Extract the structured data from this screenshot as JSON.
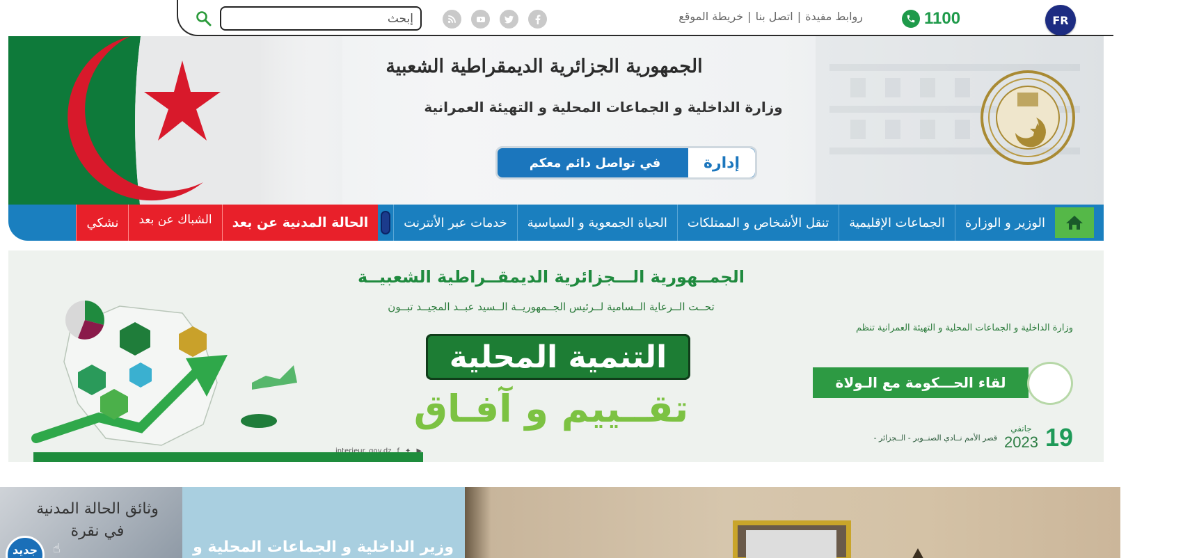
{
  "topbar": {
    "lang_button": "FR",
    "phone_number": "1100",
    "links": [
      "روابط مفيدة",
      "اتصل بنا",
      "خريطة الموقع"
    ],
    "link_separator": "|",
    "socials": [
      "facebook-icon",
      "twitter-icon",
      "youtube-icon",
      "rss-icon"
    ],
    "search_placeholder": "إبحث"
  },
  "header": {
    "line1": "الجمهورية الجزائرية الديمقراطية الشعبية",
    "line2": "وزارة الداخلية و الجماعات المحلية و التهيئة العمرانية",
    "pill_left": "إدارة",
    "pill_right": "في تواصل دائم معكم"
  },
  "nav": {
    "items": [
      "الوزير و الوزارة",
      "الجماعات الإقليمية",
      "تنقل الأشخاص و الممتلكات",
      "الحياة الجمعوية و السياسية",
      "خدمات عبر الأنترنت"
    ],
    "red_items": [
      "الحالة المدنية عن بعد",
      "الشباك عن بعد",
      "نشكي"
    ]
  },
  "banner2": {
    "title": "الجمــهورية الـــجزائرية الديمقــراطية الشعبيــة",
    "subtitle": "تحــت الــرعاية الــسامية لــرئيس الجــمهوريــة الــسيد عبــد المجيــد تبــون",
    "big": "التنمية المحلية",
    "green": "تقــييم و آفـاق",
    "organizer": "وزارة الداخلية و الجماعات المحلية و التهيئة العمرانية تنظم",
    "meeting": "لقاء الحـــكومة مع الـولاة",
    "date_day": "19",
    "date_month": "جانفي",
    "date_year": "2023",
    "place": "قصر الأمم نــادي الصنــوبر - الــجزائر -",
    "website": "interieur. gov.dz"
  },
  "bottom": {
    "doc_tile": "وثائق الحالة المدنية في نقرة",
    "new_badge": "جديد",
    "news_text": "وزير الداخلية و الجماعات المحلية و"
  },
  "colors": {
    "nav_blue": "#1a7fbf",
    "nav_red": "#e8202a",
    "home_green": "#55b848",
    "fr_blue": "#1d2c82",
    "phone_green": "#1e9a4a",
    "banner_green": "#1f8a3e"
  }
}
